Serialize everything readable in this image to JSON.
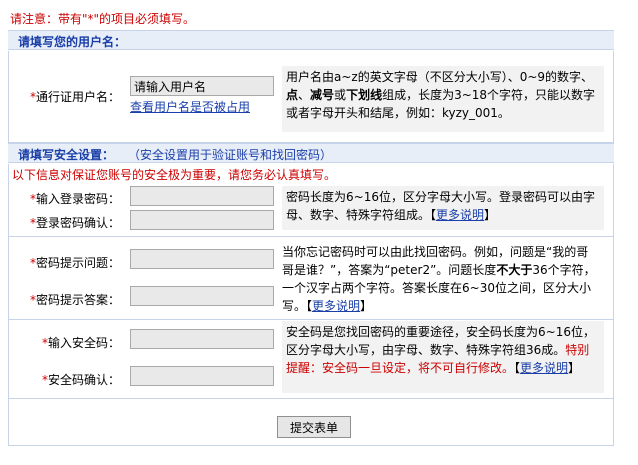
{
  "notice": "请注意：带有\"*\"的项目必须填写。",
  "username_section": {
    "title": "请填写您的用户名：",
    "label": "通行证用户名：",
    "input_value": "请输入用户名",
    "check_link": "查看用户名是否被占用",
    "help_parts": {
      "p1": "用户名由a~z的英文字母（不区分大小写）、0~9的数字、",
      "b1": "点",
      "p2": "、",
      "b2": "减号",
      "p3": "或",
      "b3": "下划线",
      "p4": "组成，长度为3~18个字符，只能以数字或者字母开头和结尾，例如：kyzy_001。"
    }
  },
  "security_section": {
    "title": "请填写安全设置：",
    "subtitle": "（安全设置用于验证账号和找回密码）",
    "warning": "以下信息对保证您账号的安全极为重要，请您务必认真填写。",
    "password_label": "输入登录密码：",
    "password_confirm_label": "登录密码确认：",
    "password_help": "密码长度为6~16位，区分字母大小写。登录密码可以由字母、数字、特殊字符组成。",
    "more_link": "更多说明",
    "question_label": "密码提示问题：",
    "answer_label": "密码提示答案：",
    "question_help": {
      "p1": "当你忘记密码时可以由此找回密码。例如，问题是“我的哥哥是谁？”，答案为“peter2”。问题长度",
      "b1": "不大于",
      "p2": "36个字符，一个汉字占两个字符。答案长度在6~30位之间，区分大小写。"
    },
    "safecode_label": "输入安全码：",
    "safecode_confirm_label": "安全码确认：",
    "safecode_help": "安全码是您找回密码的重要途径，安全码长度为6~16位，区分字母大小写，由字母、数字、特殊字符组36成。",
    "safecode_warning": "特别提醒：安全码一旦设定，将不可自行修改。"
  },
  "submit_label": "提交表单",
  "bracket_open": "【",
  "bracket_close": "】",
  "star": "*"
}
